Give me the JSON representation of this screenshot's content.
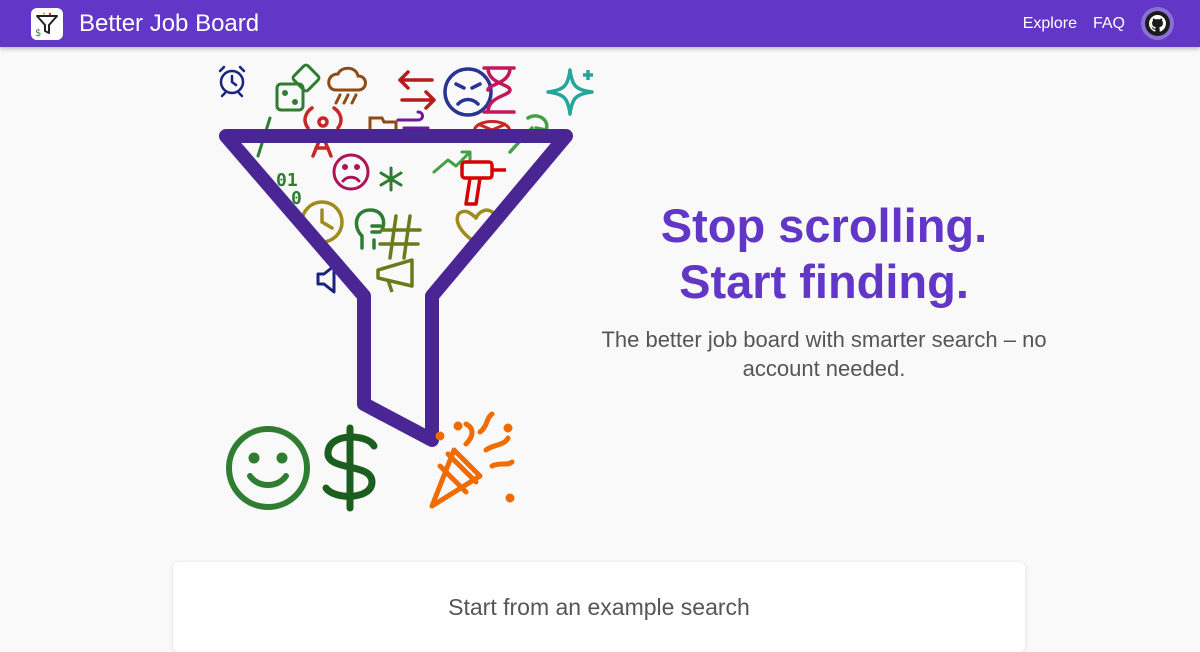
{
  "header": {
    "app_name": "Better Job Board",
    "nav": [
      {
        "label": "Explore"
      },
      {
        "label": "FAQ"
      }
    ],
    "github_icon": "github-icon"
  },
  "hero": {
    "headline_line1": "Stop scrolling.",
    "headline_line2": "Start finding.",
    "subtitle": "The better job board with smarter search – no account needed.",
    "illustration_icons": [
      "alarm-clock-icon",
      "dice-icon",
      "cloud-rain-icon",
      "swap-arrows-icon",
      "angry-face-icon",
      "hourglass-icon",
      "sparkle-icon",
      "antenna-icon",
      "letter-a-icon",
      "sad-face-icon",
      "asterisk-icon",
      "binary-icon",
      "clock-icon",
      "head-icon",
      "hash-icon",
      "megaphone-icon",
      "speaker-icon",
      "drill-icon",
      "heart-icon",
      "trend-arrow-icon",
      "wrench-icon",
      "funnel-icon",
      "smile-icon",
      "dollar-icon",
      "party-popper-icon"
    ],
    "binary_text": [
      "01",
      "0"
    ]
  },
  "examples": {
    "title": "Start from an example search"
  },
  "colors": {
    "brand": "#6236c6",
    "funnel": "#4a2594",
    "text_muted": "#555555"
  }
}
